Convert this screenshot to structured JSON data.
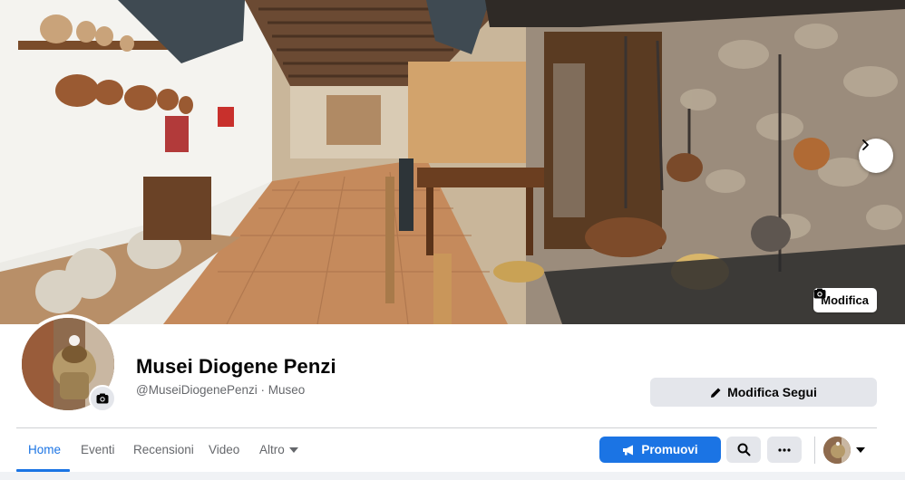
{
  "cover": {
    "edit_label": "Modifica",
    "next_icon": "chevron-right-icon",
    "edit_icon": "camera-icon"
  },
  "profile": {
    "name": "Musei Diogene Penzi",
    "subtitle": "@MuseiDiogenePenzi · Museo",
    "avatar_camera_icon": "camera-icon"
  },
  "actions": {
    "follow_label": "Modifica Segui",
    "follow_icon": "pencil-icon",
    "promote_label": "Promuovi",
    "promote_icon": "megaphone-icon",
    "search_icon": "search-icon",
    "more_icon": "more-horizontal-icon",
    "account_dropdown_icon": "caret-down-icon"
  },
  "tabs": [
    {
      "label": "Home",
      "active": true
    },
    {
      "label": "Eventi",
      "active": false
    },
    {
      "label": "Recensioni",
      "active": false
    },
    {
      "label": "Video",
      "active": false
    },
    {
      "label": "Altro",
      "active": false
    }
  ],
  "colors": {
    "accent": "#1b74e4",
    "button_gray": "#e4e6eb",
    "secondary_text": "#65676b"
  }
}
